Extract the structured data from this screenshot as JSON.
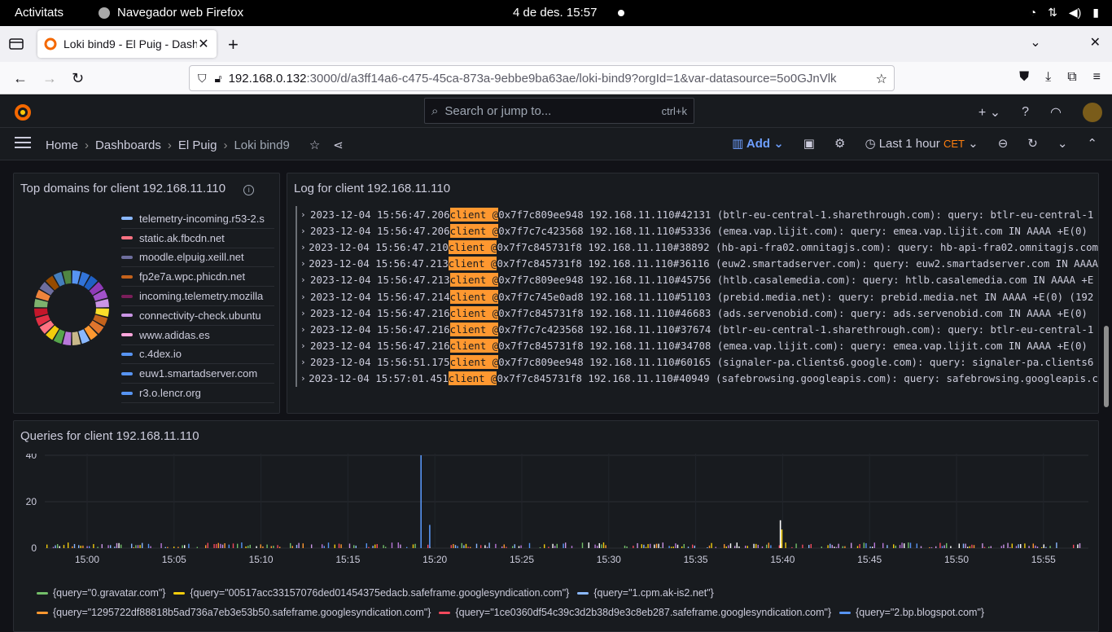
{
  "gnome": {
    "activities": "Activitats",
    "app": "Navegador web Firefox",
    "clock": "4 de des.  15:57"
  },
  "browser": {
    "tab_title": "Loki bind9 - El Puig - Dash",
    "url_host": "192.168.0.132",
    "url_path": ":3000/d/a3ff14a6-c475-45ca-873a-9ebbe9ba63ae/loki-bind9?orgId=1&var-datasource=5o0GJnVlk"
  },
  "grafana": {
    "search_placeholder": "Search or jump to...",
    "search_shortcut": "ctrl+k",
    "breadcrumb": [
      "Home",
      "Dashboards",
      "El Puig",
      "Loki bind9"
    ],
    "add_label": "Add",
    "time_range": "Last 1 hour",
    "timezone": "CET"
  },
  "panels": {
    "top_domains": {
      "title": "Top domains for client 192.168.11.110",
      "items": [
        {
          "label": "telemetry-incoming.r53-2.s",
          "color": "#8ab8ff"
        },
        {
          "label": "static.ak.fbcdn.net",
          "color": "#ff7383"
        },
        {
          "label": "moodle.elpuig.xeill.net",
          "color": "#6e6e9e"
        },
        {
          "label": "fp2e7a.wpc.phicdn.net",
          "color": "#c4621b"
        },
        {
          "label": "incoming.telemetry.mozilla",
          "color": "#7a1e5a"
        },
        {
          "label": "connectivity-check.ubuntu",
          "color": "#ca95e5"
        },
        {
          "label": "www.adidas.es",
          "color": "#ffa6dc"
        },
        {
          "label": "c.4dex.io",
          "color": "#5794f2"
        },
        {
          "label": "euw1.smartadserver.com",
          "color": "#5794f2"
        },
        {
          "label": "r3.o.lencr.org",
          "color": "#5794f2"
        }
      ],
      "donut_colors": [
        "#5794f2",
        "#3274d9",
        "#1f60c4",
        "#8f3bb8",
        "#a352cc",
        "#ca95e5",
        "#fade2a",
        "#c4621b",
        "#e0752d",
        "#ff9830",
        "#8ab8ff",
        "#c8b88a",
        "#b877d9",
        "#56a64b",
        "#f2cc0c",
        "#ff7383",
        "#e02f44",
        "#c4162a",
        "#7eb26d",
        "#ef843c",
        "#6e6e9e",
        "#964b00",
        "#447ebc",
        "#508642"
      ]
    },
    "log": {
      "title": "Log for client 192.168.11.110",
      "rows": [
        {
          "ts": "2023-12-04 15:56:47.206",
          "hl": "client @",
          "rest": "0x7f7c809ee948 192.168.11.110#42131 (btlr-eu-central-1.sharethrough.com): query: btlr-eu-central-1"
        },
        {
          "ts": "2023-12-04 15:56:47.206",
          "hl": "client @",
          "rest": "0x7f7c7c423568 192.168.11.110#53336 (emea.vap.lijit.com): query: emea.vap.lijit.com IN AAAA +E(0)"
        },
        {
          "ts": "2023-12-04 15:56:47.210",
          "hl": "client @",
          "rest": "0x7f7c845731f8 192.168.11.110#38892 (hb-api-fra02.omnitagjs.com): query: hb-api-fra02.omnitagjs.com"
        },
        {
          "ts": "2023-12-04 15:56:47.213",
          "hl": "client @",
          "rest": "0x7f7c845731f8 192.168.11.110#36116 (euw2.smartadserver.com): query: euw2.smartadserver.com IN AAAA"
        },
        {
          "ts": "2023-12-04 15:56:47.213",
          "hl": "client @",
          "rest": "0x7f7c809ee948 192.168.11.110#45756 (htlb.casalemedia.com): query: htlb.casalemedia.com IN AAAA +E"
        },
        {
          "ts": "2023-12-04 15:56:47.214",
          "hl": "client @",
          "rest": "0x7f7c745e0ad8 192.168.11.110#51103 (prebid.media.net): query: prebid.media.net IN AAAA +E(0) (192"
        },
        {
          "ts": "2023-12-04 15:56:47.216",
          "hl": "client @",
          "rest": "0x7f7c845731f8 192.168.11.110#46683 (ads.servenobid.com): query: ads.servenobid.com IN AAAA +E(0)"
        },
        {
          "ts": "2023-12-04 15:56:47.216",
          "hl": "client @",
          "rest": "0x7f7c7c423568 192.168.11.110#37674 (btlr-eu-central-1.sharethrough.com): query: btlr-eu-central-1"
        },
        {
          "ts": "2023-12-04 15:56:47.216",
          "hl": "client @",
          "rest": "0x7f7c845731f8 192.168.11.110#34708 (emea.vap.lijit.com): query: emea.vap.lijit.com IN AAAA +E(0)"
        },
        {
          "ts": "2023-12-04 15:56:51.175",
          "hl": "client @",
          "rest": "0x7f7c809ee948 192.168.11.110#60165 (signaler-pa.clients6.google.com): query: signaler-pa.clients6"
        },
        {
          "ts": "2023-12-04 15:57:01.451",
          "hl": "client @",
          "rest": "0x7f7c845731f8 192.168.11.110#40949 (safebrowsing.googleapis.com): query: safebrowsing.googleapis.c"
        }
      ]
    },
    "queries": {
      "title": "Queries for client 192.168.11.110"
    }
  },
  "chart_data": {
    "type": "bar",
    "x_ticks": [
      "15:00",
      "15:05",
      "15:10",
      "15:15",
      "15:20",
      "15:25",
      "15:30",
      "15:35",
      "15:40",
      "15:45",
      "15:50",
      "15:55"
    ],
    "y_ticks": [
      0,
      20,
      40
    ],
    "ylim": [
      0,
      40
    ],
    "spikes": [
      {
        "x": "15:19:10",
        "y": 40,
        "color": "#5794f2"
      },
      {
        "x": "15:19:40",
        "y": 10,
        "color": "#5794f2"
      },
      {
        "x": "15:39:50",
        "y": 12,
        "color": "#ffffff"
      },
      {
        "x": "15:39:55",
        "y": 8,
        "color": "#f2cc0c"
      }
    ],
    "legend": [
      {
        "label": "{query=\"0.gravatar.com\"}",
        "color": "#73bf69"
      },
      {
        "label": "{query=\"00517acc33157076ded01454375edacb.safeframe.googlesyndication.com\"}",
        "color": "#f2cc0c"
      },
      {
        "label": "{query=\"1.cpm.ak-is2.net\"}",
        "color": "#8ab8ff"
      },
      {
        "label": "{query=\"1295722df88818b5ad736a7eb3e53b50.safeframe.googlesyndication.com\"}",
        "color": "#ff9830"
      },
      {
        "label": "{query=\"1ce0360df54c39c3d2b38d9e3c8eb287.safeframe.googlesyndication.com\"}",
        "color": "#f2495c"
      },
      {
        "label": "{query=\"2.bp.blogspot.com\"}",
        "color": "#5794f2"
      }
    ]
  }
}
